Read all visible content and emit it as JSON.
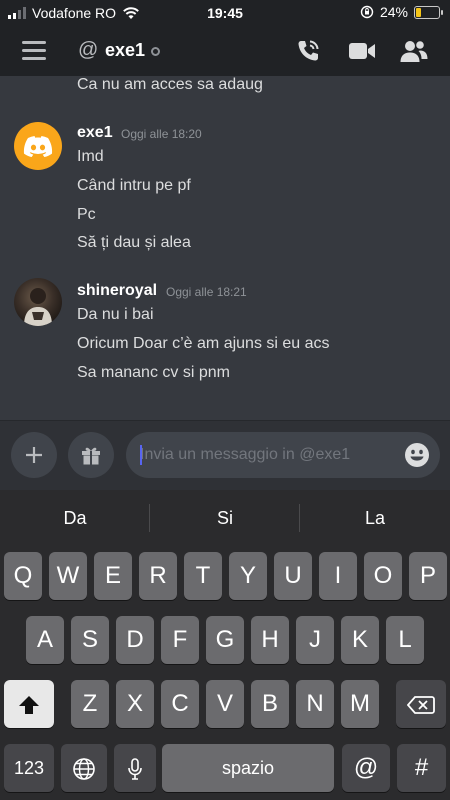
{
  "status_bar": {
    "carrier": "Vodafone RO",
    "time": "19:45",
    "battery_percent": "24%",
    "battery_level": 0.24,
    "icons": [
      "signal-icon",
      "wifi-icon",
      "orientation-lock-icon",
      "battery-icon"
    ]
  },
  "header": {
    "channel_name": "exe1",
    "icons": [
      "hamburger-menu-icon",
      "at-icon",
      "status-dot-icon",
      "voice-call-icon",
      "video-call-icon",
      "members-icon"
    ]
  },
  "messages": {
    "top_line": "Ca nu am acces sa adaug",
    "groups": [
      {
        "author": "exe1",
        "timestamp": "Oggi alle 18:20",
        "lines": [
          "Imd",
          "Când intru pe pf",
          "Pc",
          "Să ți dau și alea"
        ]
      },
      {
        "author": "shineroyal",
        "timestamp": "Oggi alle 18:21",
        "lines": [
          "Da nu i bai",
          "Oricum Doar c’è am ajuns si eu acs",
          "Sa mananc cv si pnm"
        ]
      }
    ]
  },
  "composer": {
    "placeholder": "Invia un messaggio in @exe1",
    "value": "",
    "icons": [
      "plus-icon",
      "gift-icon",
      "emoji-icon"
    ]
  },
  "keyboard": {
    "suggestions": [
      "Da",
      "Si",
      "La"
    ],
    "row1": [
      "Q",
      "W",
      "E",
      "R",
      "T",
      "Y",
      "U",
      "I",
      "O",
      "P"
    ],
    "row2": [
      "A",
      "S",
      "D",
      "F",
      "G",
      "H",
      "J",
      "K",
      "L"
    ],
    "row3": [
      "Z",
      "X",
      "C",
      "V",
      "B",
      "N",
      "M"
    ],
    "numbers_key": "123",
    "space_key": "spazio",
    "at_key": "@",
    "hash_key": "#",
    "icons": [
      "shift-icon",
      "backspace-icon",
      "globe-icon",
      "microphone-icon"
    ]
  },
  "colors": {
    "background": "#36393f",
    "header": "#202225",
    "discord_avatar": "#faa61a",
    "battery": "#f5c518"
  }
}
